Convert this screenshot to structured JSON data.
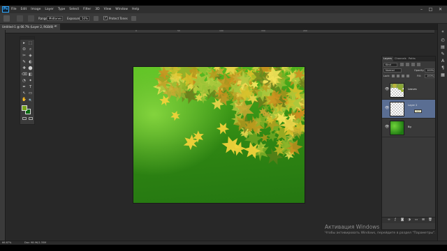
{
  "app": {
    "logo": "Ps"
  },
  "menu": [
    "File",
    "Edit",
    "Image",
    "Layer",
    "Type",
    "Select",
    "Filter",
    "3D",
    "View",
    "Window",
    "Help"
  ],
  "window_controls": {
    "minimize": "–",
    "maximize": "□",
    "close": "✕"
  },
  "options_bar": {
    "range_label": "Range:",
    "range_value": "Midtones",
    "exposure_label": "Exposure:",
    "exposure_value": "50%",
    "protect_label": "Protect Tones",
    "protect_checked": "✓"
  },
  "document": {
    "tab_title": "Untitled-1 @ 66.7% (Layer 2, RGB/8) *",
    "close": "×"
  },
  "ruler": {
    "top_labels": [
      "0",
      "50",
      "100",
      "150",
      "200"
    ]
  },
  "tools": [
    "▸",
    "⬚",
    "ʘ",
    "⌕",
    "✂",
    "◈",
    "✎",
    "◐",
    "✚",
    "⬤",
    "⌫",
    "◧",
    "◔",
    "✦",
    "✒",
    "T",
    "↖",
    "▭",
    "✋",
    "🔍"
  ],
  "colors": {
    "foreground": "#7aa61b",
    "background": "#0b6b12",
    "selection": "#5a6e93"
  },
  "layers_panel": {
    "tabs": [
      "Layers",
      "Channels",
      "Paths"
    ],
    "kind_label": "Kind",
    "blend_mode": "Normal",
    "opacity_label": "Opacity:",
    "opacity_value": "100%",
    "lock_label": "Lock:",
    "fill_label": "Fill:",
    "fill_value": "100%",
    "layers": [
      {
        "name": "Leaves",
        "selected": false
      },
      {
        "name": "Layer 2",
        "selected": true
      },
      {
        "name": "Bg",
        "selected": false
      }
    ],
    "tooltip": "Layer 2",
    "footer_icons": [
      "link-icon",
      "fx-icon",
      "mask-icon",
      "adjustment-icon",
      "folder-icon",
      "new-layer-icon",
      "trash-icon"
    ]
  },
  "status_bar": {
    "zoom": "66.67%",
    "doc_info": "Doc: 98.9K/1.35M"
  },
  "watermark": {
    "title": "Активация Windows",
    "subtitle": "Чтобы активировать Windows, перейдите в раздел \"Параметры\"."
  }
}
